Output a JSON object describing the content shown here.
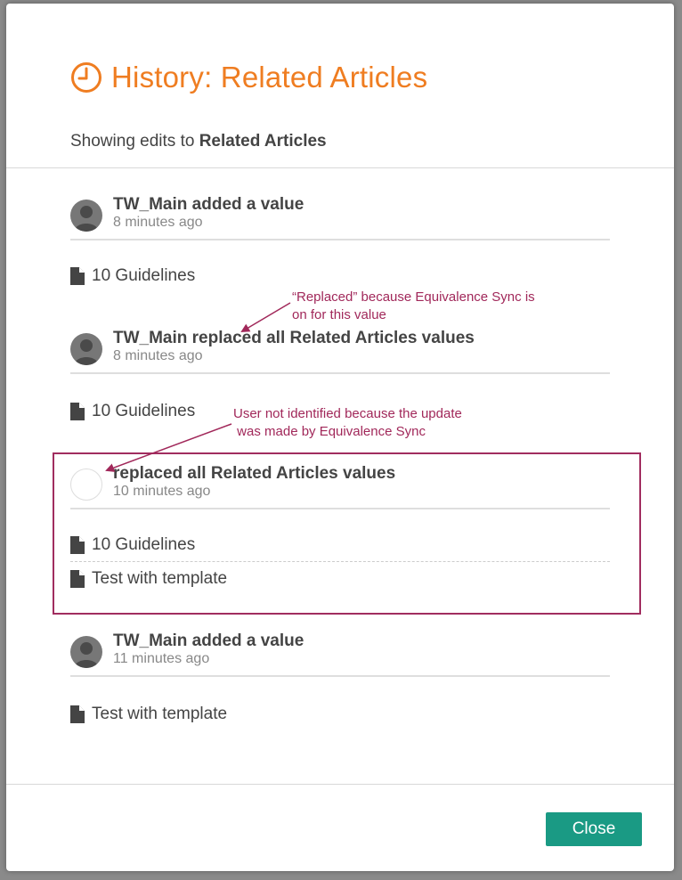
{
  "modal": {
    "title": "History: Related Articles",
    "subtitle_prefix": "Showing edits to",
    "subtitle_target": "Related Articles",
    "close_label": "Close",
    "accent_color": "#ef7d21",
    "button_color": "#1a9a84",
    "annotation_color": "#a1285a"
  },
  "entries": [
    {
      "title": "TW_Main added a value",
      "time": "8 minutes ago",
      "avatar": "user-avatar-icon",
      "items": [
        "10 Guidelines"
      ]
    },
    {
      "title": "TW_Main replaced all Related Articles values",
      "time": "8 minutes ago",
      "avatar": "user-avatar-icon",
      "items": [
        "10 Guidelines"
      ]
    },
    {
      "title": "replaced all Related Articles values",
      "time": "10 minutes ago",
      "avatar": "empty-avatar",
      "items": [
        "10 Guidelines",
        "Test with template"
      ]
    },
    {
      "title": "TW_Main added a value",
      "time": "11 minutes ago",
      "avatar": "user-avatar-icon",
      "items": [
        "Test with template"
      ]
    }
  ],
  "annotations": [
    "“Replaced” because Equivalence Sync is\non for this value",
    "User not identified because the update\n was made by Equivalence Sync"
  ]
}
